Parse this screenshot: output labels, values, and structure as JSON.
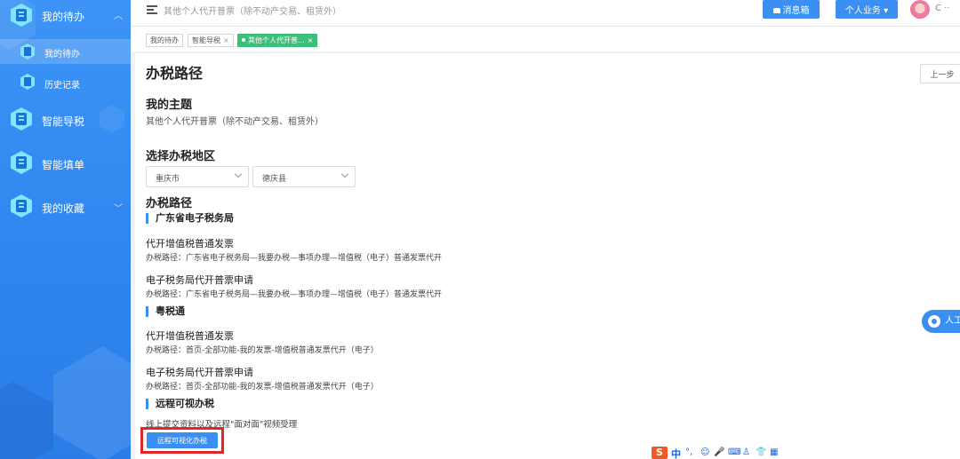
{
  "sidebar": {
    "items": [
      {
        "label": "我的待办",
        "icon": "todo-icon",
        "expanded": true
      },
      {
        "label": "智能导税",
        "icon": "guide-icon"
      },
      {
        "label": "智能填单",
        "icon": "form-icon"
      },
      {
        "label": "我的收藏",
        "icon": "favorite-icon",
        "expanded": false
      }
    ],
    "subitems": [
      {
        "label": "我的待办",
        "active": true
      },
      {
        "label": "历史记录"
      }
    ]
  },
  "topbar": {
    "title": "其他个人代开普票（除不动产交易、租赁外）",
    "msg_button": "消息箱",
    "personal_button": "个人业务 ▾",
    "user_name": "C ··"
  },
  "tabs": [
    {
      "label": "我的待办",
      "closable": false
    },
    {
      "label": "智能导税",
      "closable": true
    },
    {
      "label": "其他个人代开普...",
      "closable": true,
      "active": true
    }
  ],
  "main": {
    "page_title": "办税路径",
    "prev_button": "上一步",
    "theme_heading": "我的主题",
    "theme_text": "其他个人代开普票（除不动产交易、租赁外）",
    "region_heading": "选择办税地区",
    "city_select": "重庆市",
    "county_select": "德庆县",
    "path_heading": "办税路径",
    "groups": [
      {
        "name": "广东省电子税务局",
        "items": [
          {
            "title": "代开增值税普通发票",
            "path": "办税路径：广东省电子税务局—我要办税—事项办理—增值税（电子）普通发票代开"
          },
          {
            "title": "电子税务局代开普票申请",
            "path": "办税路径：广东省电子税务局—我要办税—事项办理—增值税（电子）普通发票代开"
          }
        ]
      },
      {
        "name": "粤税通",
        "items": [
          {
            "title": "代开增值税普通发票",
            "path": "办税路径：首页-全部功能-我的发票-增值税普通发票代开（电子）"
          },
          {
            "title": "电子税务局代开普票申请",
            "path": "办税路径：首页-全部功能-我的发票-增值税普通发票代开（电子）"
          }
        ]
      },
      {
        "name": "远程可视办税",
        "desc": "线上提交资料以及远程\"面对面\"视频受理",
        "button": "远程可视化办税"
      }
    ]
  },
  "float_service": "人工",
  "ime": {
    "logo": "S",
    "lang": "中",
    "symbols": [
      "°,",
      "☺",
      "🎤",
      "⌨",
      "♙",
      "👕",
      "▦"
    ]
  },
  "colors": {
    "primary": "#3c8ff2",
    "active_tab": "#3dbf7a",
    "highlight": "#e52424",
    "sidebar": "#2f86ef"
  }
}
